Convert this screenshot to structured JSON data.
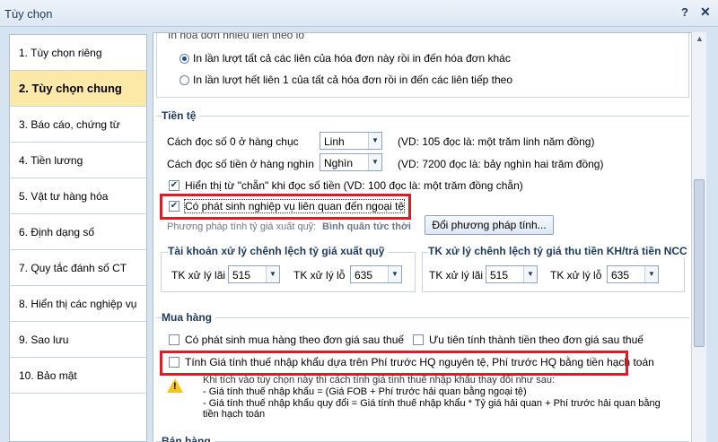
{
  "window": {
    "title": "Tùy chọn",
    "help_label": "?",
    "close_label": "✕"
  },
  "sidebar": {
    "items": [
      {
        "label": "1. Tùy chọn riêng"
      },
      {
        "label": "2. Tùy chọn chung"
      },
      {
        "label": "3. Báo cáo, chứng từ"
      },
      {
        "label": "4. Tiền lương"
      },
      {
        "label": "5. Vật tư hàng hóa"
      },
      {
        "label": "6. Định dạng số"
      },
      {
        "label": "7. Quy tắc đánh số CT"
      },
      {
        "label": "8. Hiển thị các nghiệp vụ"
      },
      {
        "label": "9. Sao lưu"
      },
      {
        "label": "10. Bảo mật"
      }
    ],
    "active_index": 1
  },
  "invoice": {
    "truncated_label": "In hóa đơn nhiều liên theo lô",
    "option_1": "In lần lượt tất cả các liên của hóa đơn này rồi in đến hóa đơn khác",
    "option_2": "In lần lượt hết liên 1 của tất cả hóa đơn rồi in đến các liên tiếp theo"
  },
  "tien_te": {
    "title": "Tiền tệ",
    "row1_label": "Cách đọc số 0 ở hàng chục",
    "row1_value": "Linh",
    "row1_example": "(VD: 105 đọc là: một trăm linh năm đồng)",
    "row2_label": "Cách đọc số tiền ở hàng nghìn",
    "row2_value": "Nghìn",
    "row2_example": "(VD: 7200 đọc là: bảy nghìn hai trăm đồng)",
    "chan_label": "Hiển thị từ \"chẵn\" khi đọc số tiền (VD: 100 đọc là: một trăm đồng chẵn)",
    "ngoai_te_label": "Có phát sinh nghiệp vụ liên quan đến ngoại tệ",
    "method_label": "Phương pháp tính tỷ giá xuất quỹ:",
    "method_value": "Bình quân tức thời",
    "change_method_button": "Đổi phương pháp tính...",
    "xuat_quy_group": {
      "title": "Tài khoản xử lý chênh lệch tỷ giá xuất quỹ",
      "lai_label": "TK xử lý lãi",
      "lai_value": "515",
      "lo_label": "TK xử lý lỗ",
      "lo_value": "635"
    },
    "thu_tien_group": {
      "title": "TK xử lý chênh lệch tỷ giá thu tiền KH/trả tiền NCC",
      "lai_label": "TK xử lý lãi",
      "lai_value": "515",
      "lo_label": "TK xử lý lỗ",
      "lo_value": "635"
    }
  },
  "mua_hang": {
    "title": "Mua hàng",
    "opt1": "Có phát sinh mua hàng theo đơn giá sau thuế",
    "opt2": "Ưu tiên tính thành tiền theo đơn giá sau thuế",
    "opt3": "Tính Giá tính thuế nhập khẩu dựa trên Phí trước HQ nguyên tệ, Phí trước HQ bằng tiền hạch toán",
    "note_line1": "Khi tích vào tùy chọn này thì cách tính giá tính thuế nhập khẩu thay đổi như sau:",
    "note_line2": "- Giá tính thuế nhập khẩu = (Giá FOB + Phí trước hải quan bằng ngoại tệ)",
    "note_line3": "- Giá tính thuế nhập khẩu quy đổi = Giá tính thuế nhập khẩu * Tỷ giá hải quan + Phí trước hải quan bằng",
    "note_line4": "tiền hạch toán"
  },
  "ban_hang": {
    "title": "Bán hàng"
  }
}
